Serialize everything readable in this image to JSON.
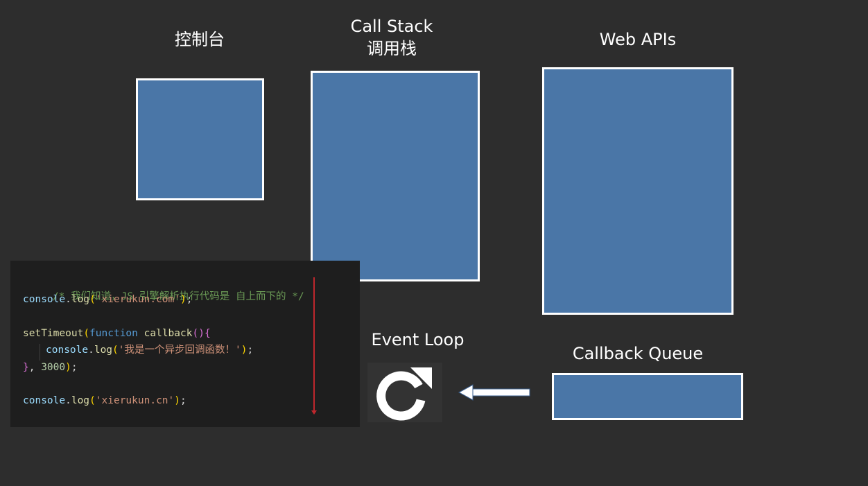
{
  "labels": {
    "console": "控制台",
    "call_stack_en": "Call Stack",
    "call_stack_zh": "调用栈",
    "web_apis": "Web APIs",
    "event_loop": "Event Loop",
    "callback_queue": "Callback Queue"
  },
  "code": {
    "comment": "/* 我们知道，JS 引擎解析执行代码是 自上而下的 */",
    "line1": {
      "obj": "console",
      "dot": ".",
      "fn": "log",
      "open": "(",
      "str": "'xierukun.com'",
      "close": ")",
      "semi": ";"
    },
    "line3": {
      "fn": "setTimeout",
      "open": "(",
      "kw": "function",
      "space": " ",
      "name": "callback",
      "params": "()",
      "brace": "{"
    },
    "line4": {
      "obj": "console",
      "dot": ".",
      "fn": "log",
      "open": "(",
      "str": "'我是一个异步回调函数！'",
      "close": ")",
      "semi": ";"
    },
    "line5": {
      "brace": "}",
      "comma": ", ",
      "num": "3000",
      "close": ")",
      "semi": ";"
    },
    "line7": {
      "obj": "console",
      "dot": ".",
      "fn": "log",
      "open": "(",
      "str": "'xierukun.cn'",
      "close": ")",
      "semi": ";"
    }
  },
  "colors": {
    "background": "#2d2d2d",
    "box_fill": "#4a76a7",
    "box_border": "#ffffff",
    "code_bg": "#1e1e1e",
    "red_marker": "#c0272d"
  },
  "icons": {
    "event_loop": "refresh-icon",
    "queue_to_loop": "arrow-left-icon"
  }
}
